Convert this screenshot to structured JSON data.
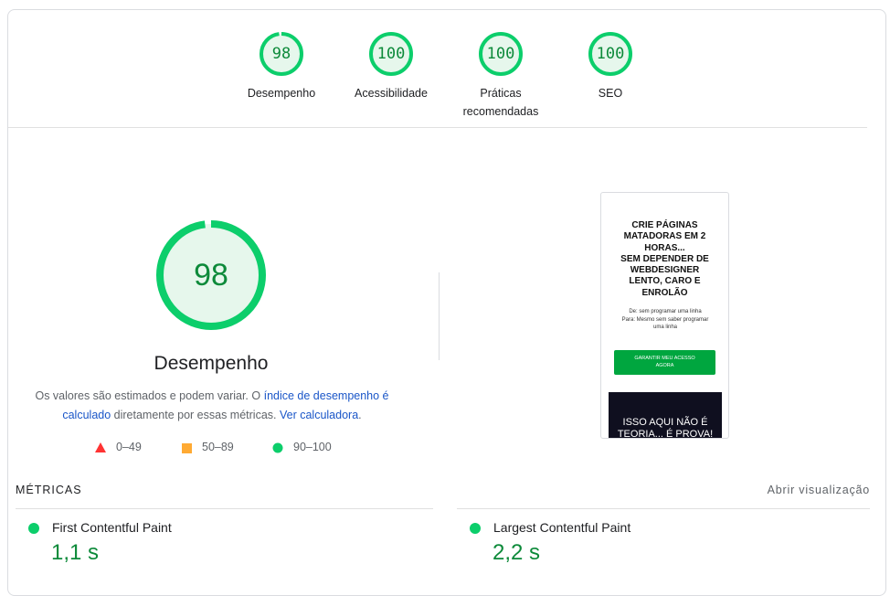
{
  "categories": [
    {
      "score": "98",
      "label": "Desempenho",
      "fraction": 0.98
    },
    {
      "score": "100",
      "label": "Acessibilidade",
      "fraction": 1.0
    },
    {
      "score": "100",
      "label_line1": "Práticas",
      "label_line2": "recomendadas",
      "fraction": 1.0
    },
    {
      "score": "100",
      "label": "SEO",
      "fraction": 1.0
    }
  ],
  "performance": {
    "score": "98",
    "fraction": 0.98,
    "title": "Desempenho",
    "desc_part1": "Os valores são estimados e podem variar. O ",
    "desc_link1": "índice de desempenho é calculado",
    "desc_part2": " diretamente por essas métricas. ",
    "desc_link2": "Ver calculadora",
    "desc_part3": "."
  },
  "legend": [
    {
      "range": "0–49",
      "color": "#ff3333"
    },
    {
      "range": "50–89",
      "color": "#ffaa33"
    },
    {
      "range": "90–100",
      "color": "#0cce6b"
    }
  ],
  "screenshot": {
    "headline_1": "CRIE PÁGINAS",
    "headline_2": "MATADORAS EM 2",
    "headline_3": "HORAS...",
    "headline_4": "SEM DEPENDER DE",
    "headline_5": "WEBDESIGNER",
    "headline_6": "LENTO, CARO E",
    "headline_7": "ENROLÃO",
    "sub_1": "De: sem programar uma linha",
    "sub_2": "Para: Mesmo sem saber programar",
    "sub_3": "uma linha",
    "button_1": "GARANTIR MEU ACESSO",
    "button_2": "AGORA",
    "dark_text": "ISSO AQUI NÃO É TEORIA... É PROVA!"
  },
  "metrics": {
    "title": "MÉTRICAS",
    "open_view": "Abrir visualização",
    "items": [
      {
        "name": "First Contentful Paint",
        "value": "1,1 s"
      },
      {
        "name": "Largest Contentful Paint",
        "value": "2,2 s"
      }
    ]
  },
  "colors": {
    "pass": "#0cce6b",
    "pass_text": "#0d8a3a",
    "link": "#1a56c8"
  }
}
